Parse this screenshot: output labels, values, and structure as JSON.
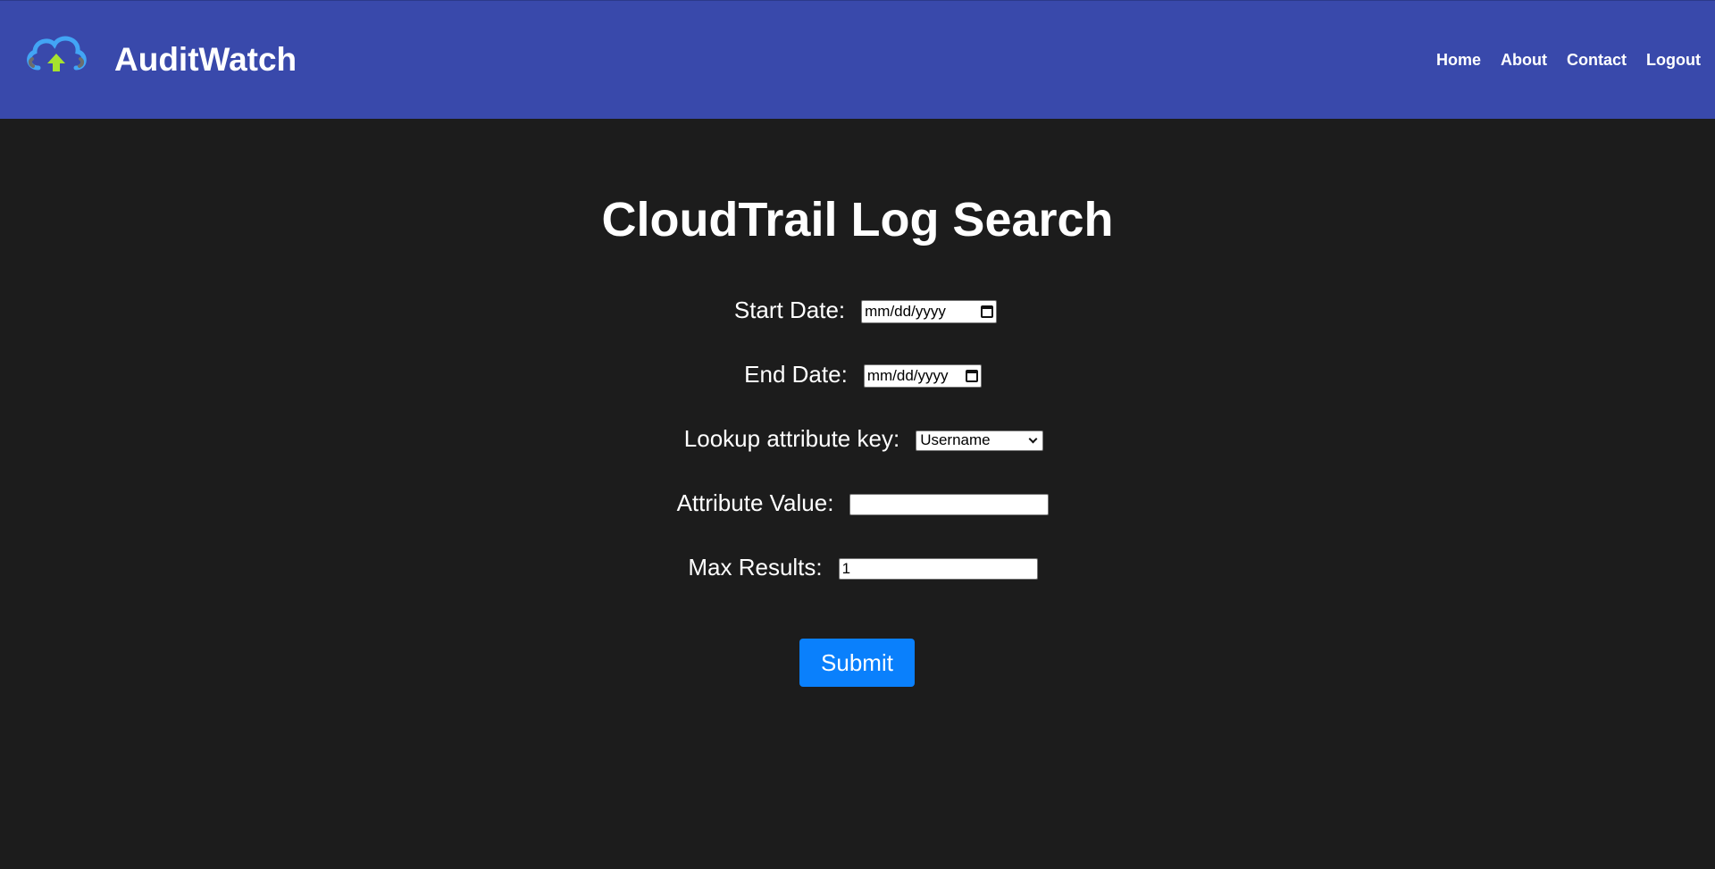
{
  "header": {
    "logo_icon": "cloud-upload-icon",
    "brand_name": "AuditWatch",
    "nav": [
      "Home",
      "About",
      "Contact",
      "Logout"
    ],
    "background_color": "#3949ab"
  },
  "main": {
    "title": "CloudTrail Log Search",
    "fields": {
      "start_date": {
        "label": "Start Date:",
        "placeholder": "mm/dd/yyyy"
      },
      "end_date": {
        "label": "End Date:",
        "placeholder": "mm/dd/yyyy"
      },
      "lookup_key": {
        "label": "Lookup attribute key:",
        "selected": "Username"
      },
      "attribute_value": {
        "label": "Attribute Value:",
        "value": ""
      },
      "max_results": {
        "label": "Max Results:",
        "value": "1"
      }
    },
    "submit_label": "Submit",
    "submit_color": "#0a80fc",
    "background_color": "#1c1c1c"
  }
}
